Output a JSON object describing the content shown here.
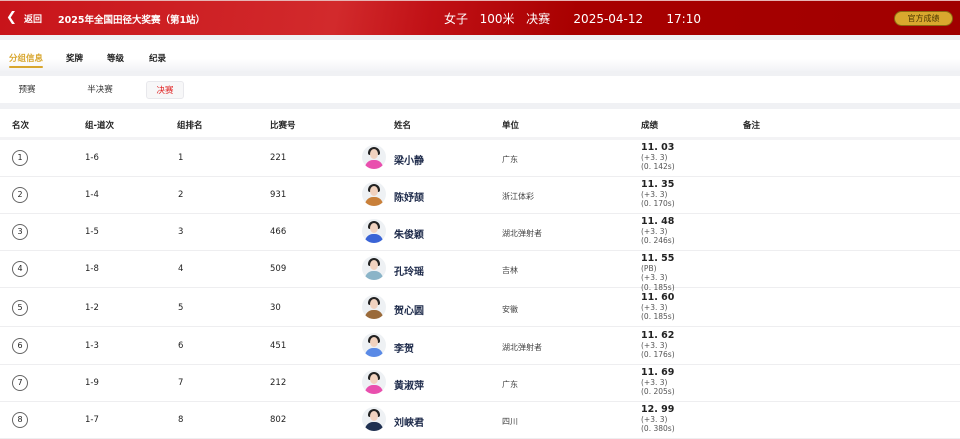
{
  "header": {
    "back_label": "返回",
    "competition": "2025年全国田径大奖赛（第1站）",
    "event": "女子  100米  决赛    2025-04-12    17:10",
    "official_button": "官方成绩"
  },
  "tabs": [
    "分组信息",
    "奖牌",
    "等级",
    "纪录"
  ],
  "rounds": [
    "预赛",
    "半决赛",
    "决赛"
  ],
  "columns": [
    "名次",
    "组-道次",
    "组排名",
    "比赛号",
    "姓名",
    "单位",
    "成绩",
    "备注"
  ],
  "colors": {
    "accent": "#d8a62e",
    "brand": "#c8141a",
    "active_round": "#e02020"
  },
  "rows": [
    {
      "rank": "1",
      "lane": "1-6",
      "group_rank": "1",
      "bib": "221",
      "name": "梁小静",
      "unit": "广东",
      "result": "11. 03",
      "notes": [
        "(+3. 3)",
        "(0. 142s)"
      ],
      "shirt": "#e94fae"
    },
    {
      "rank": "2",
      "lane": "1-4",
      "group_rank": "2",
      "bib": "931",
      "name": "陈妤颉",
      "unit": "浙江体彩",
      "result": "11. 35",
      "notes": [
        "(+3. 3)",
        "(0. 170s)"
      ],
      "shirt": "#c9803a"
    },
    {
      "rank": "3",
      "lane": "1-5",
      "group_rank": "3",
      "bib": "466",
      "name": "朱俊颖",
      "unit": "湖北弹射者",
      "result": "11. 48",
      "notes": [
        "(+3. 3)",
        "(0. 246s)"
      ],
      "shirt": "#3a64d6"
    },
    {
      "rank": "4",
      "lane": "1-8",
      "group_rank": "4",
      "bib": "509",
      "name": "孔玲瑶",
      "unit": "吉林",
      "result": "11. 55",
      "notes": [
        "(PB)",
        "(+3. 3)",
        "(0. 185s)"
      ],
      "shirt": "#8ab4c8"
    },
    {
      "rank": "5",
      "lane": "1-2",
      "group_rank": "5",
      "bib": "30",
      "name": "贺心圆",
      "unit": "安徽",
      "result": "11. 60",
      "notes": [
        "(+3. 3)",
        "(0. 185s)"
      ],
      "shirt": "#9a6a3a"
    },
    {
      "rank": "6",
      "lane": "1-3",
      "group_rank": "6",
      "bib": "451",
      "name": "李贺",
      "unit": "湖北弹射者",
      "result": "11. 62",
      "notes": [
        "(+3. 3)",
        "(0. 176s)"
      ],
      "shirt": "#5a8ae6"
    },
    {
      "rank": "7",
      "lane": "1-9",
      "group_rank": "7",
      "bib": "212",
      "name": "黄淑萍",
      "unit": "广东",
      "result": "11. 69",
      "notes": [
        "(+3. 3)",
        "(0. 205s)"
      ],
      "shirt": "#e94fae"
    },
    {
      "rank": "8",
      "lane": "1-7",
      "group_rank": "8",
      "bib": "802",
      "name": "刘峡君",
      "unit": "四川",
      "result": "12. 99",
      "notes": [
        "(+3. 3)",
        "(0. 380s)"
      ],
      "shirt": "#1f3050"
    }
  ]
}
